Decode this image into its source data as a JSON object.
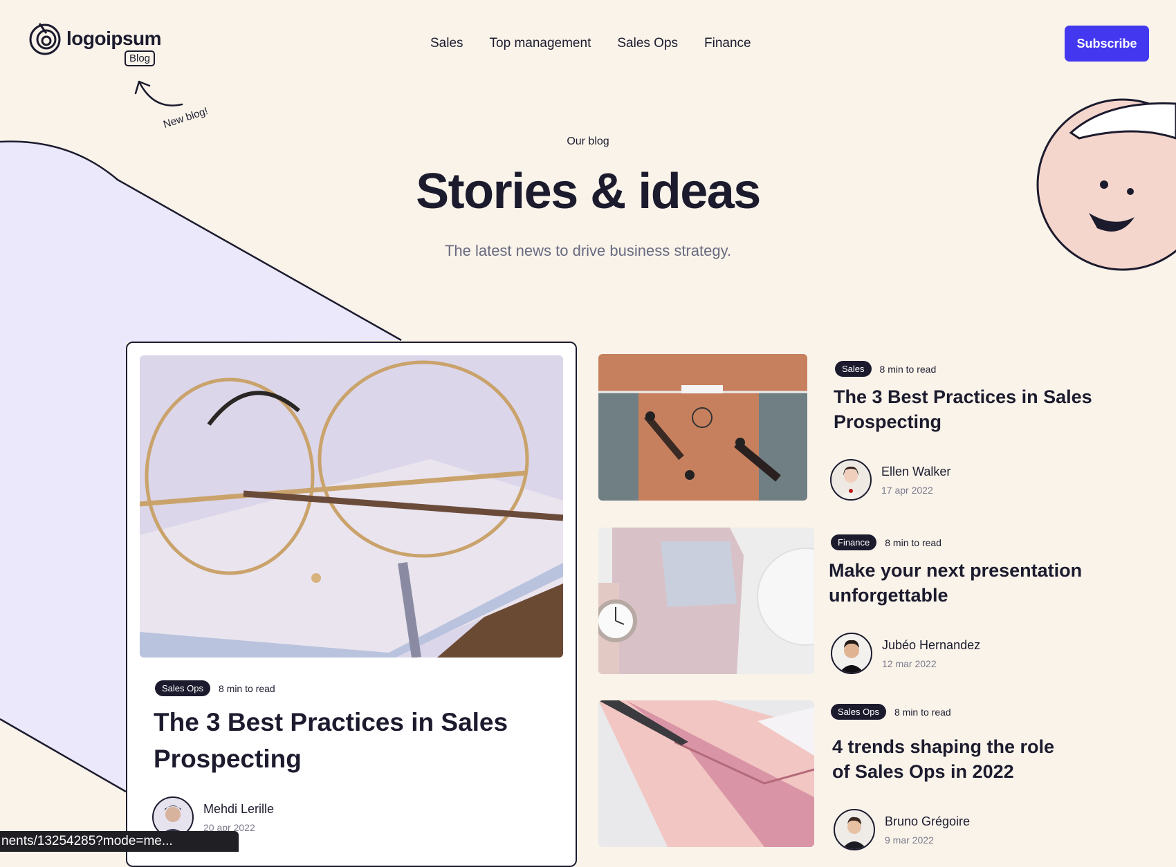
{
  "header": {
    "logo_text": "logoipsum",
    "blog_badge": "Blog",
    "new_blog_note": "New blog!",
    "nav": [
      "Sales",
      "Top management",
      "Sales Ops",
      "Finance"
    ],
    "subscribe_label": "Subscribe"
  },
  "hero": {
    "eyebrow": "Our blog",
    "title": "Stories & ideas",
    "subtitle": "The latest news to drive business strategy."
  },
  "featured": {
    "tag": "Sales Ops",
    "read_time": "8 min to read",
    "title": "The 3 Best Practices in Sales Prospecting",
    "author": "Mehdi Lerille",
    "date": "20 apr 2022"
  },
  "posts": [
    {
      "tag": "Sales",
      "read_time": "8 min to read",
      "title": "The 3 Best Practices in Sales Prospecting",
      "author": "Ellen Walker",
      "date": "17 apr 2022"
    },
    {
      "tag": "Finance",
      "read_time": "8 min to read",
      "title": "Make your next presentation unforgettable",
      "author": "Jubéo Hernandez",
      "date": "12 mar 2022"
    },
    {
      "tag": "Sales Ops",
      "read_time": "8 min to read",
      "title": "4 trends shaping the role of Sales Ops in 2022",
      "author": "Bruno Grégoire",
      "date": "9 mar 2022"
    }
  ],
  "status_bar_url": "nents/13254285?mode=me...",
  "colors": {
    "background": "#f9f3ea",
    "accent": "#4338f0",
    "lavender": "#ebe8fb",
    "ink": "#1c1b2e"
  }
}
